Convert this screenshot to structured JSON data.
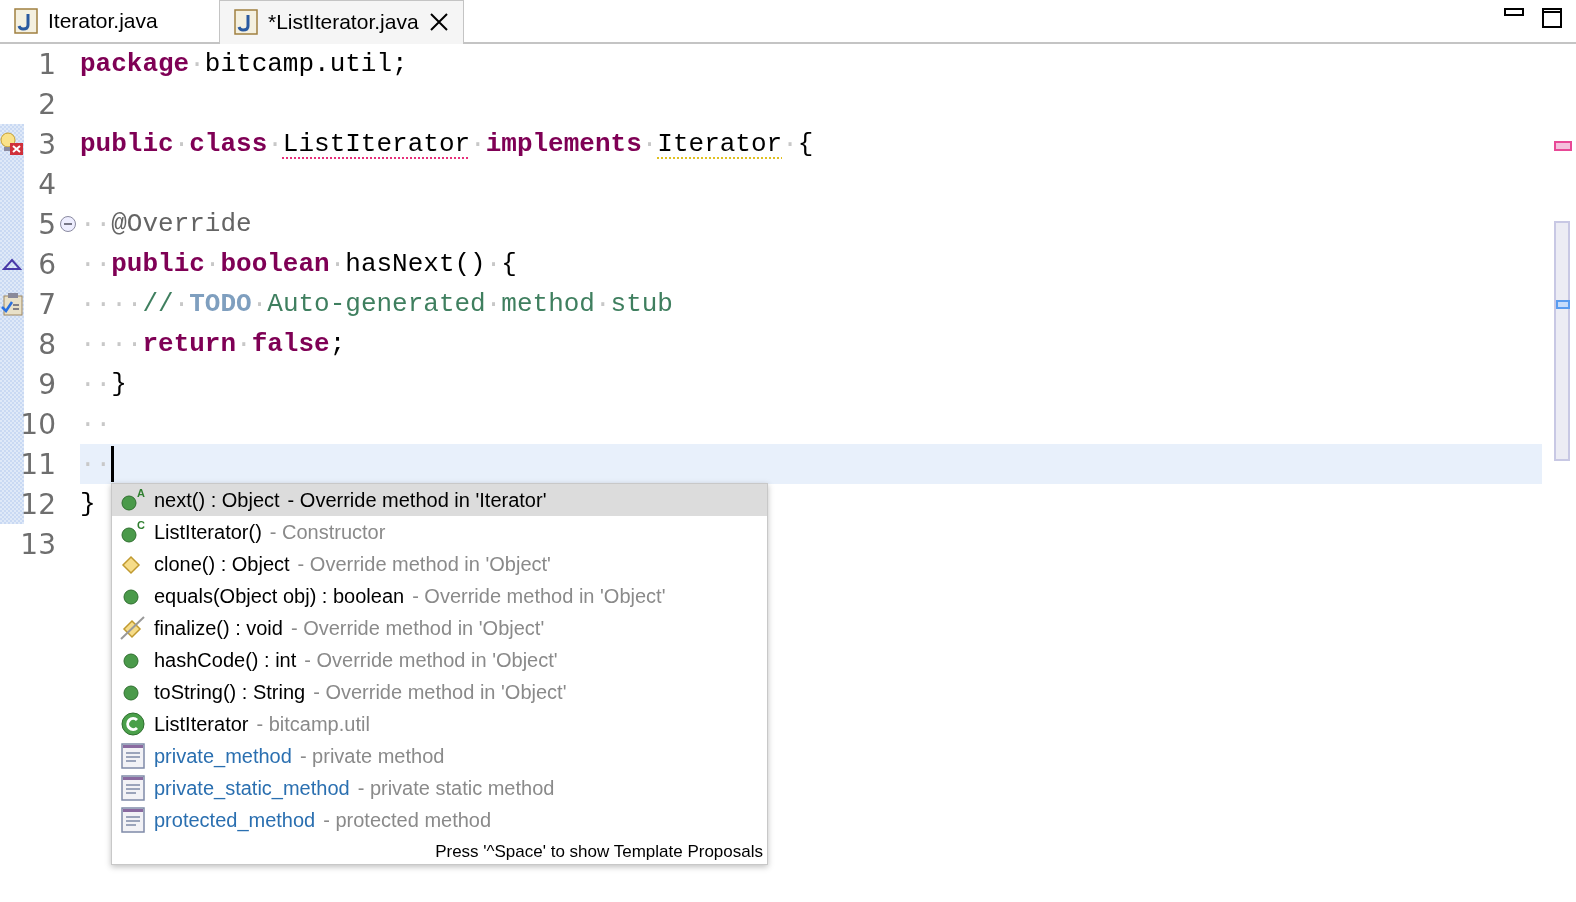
{
  "tabs": [
    {
      "label": "Iterator.java",
      "selected": false,
      "closable": false
    },
    {
      "label": "*ListIterator.java",
      "selected": true,
      "closable": true
    }
  ],
  "editor": {
    "lines": [
      {
        "number": "1",
        "current": false,
        "kind": "plain",
        "fold": false,
        "tokens": [
          {
            "kind": "keyword",
            "text": "package"
          },
          {
            "kind": "ws",
            "text": "·"
          },
          {
            "kind": "plain",
            "text": "bitcamp.util;"
          }
        ]
      },
      {
        "number": "2",
        "current": false,
        "kind": "plain",
        "fold": false
      },
      {
        "number": "3",
        "current": false,
        "kind": "error",
        "fold": false,
        "tokens": [
          {
            "kind": "keyword",
            "text": "public"
          },
          {
            "kind": "ws",
            "text": "·"
          },
          {
            "kind": "keyword",
            "text": "class"
          },
          {
            "kind": "ws",
            "text": "·"
          },
          {
            "kind": "error",
            "text": "ListIterator"
          },
          {
            "kind": "ws",
            "text": "·"
          },
          {
            "kind": "keyword",
            "text": "implements"
          },
          {
            "kind": "ws",
            "text": "·"
          },
          {
            "kind": "warning",
            "text": "Iterator"
          },
          {
            "kind": "ws",
            "text": "·"
          },
          {
            "kind": "plain",
            "text": "{"
          }
        ]
      },
      {
        "number": "4",
        "current": false,
        "kind": "plain",
        "fold": false
      },
      {
        "number": "5",
        "current": false,
        "kind": "plain",
        "fold": true,
        "tokens": [
          {
            "kind": "ws",
            "text": "··"
          },
          {
            "kind": "annotation",
            "text": "@Override"
          }
        ]
      },
      {
        "number": "6",
        "current": false,
        "kind": "override",
        "fold": false,
        "tokens": [
          {
            "kind": "ws",
            "text": "··"
          },
          {
            "kind": "keyword",
            "text": "public"
          },
          {
            "kind": "ws",
            "text": "·"
          },
          {
            "kind": "keyword",
            "text": "boolean"
          },
          {
            "kind": "ws",
            "text": "·"
          },
          {
            "kind": "plain",
            "text": "hasNext()"
          },
          {
            "kind": "ws",
            "text": "·"
          },
          {
            "kind": "plain",
            "text": "{"
          }
        ]
      },
      {
        "number": "7",
        "current": false,
        "kind": "task",
        "fold": false,
        "tokens": [
          {
            "kind": "ws",
            "text": "····"
          },
          {
            "kind": "comment",
            "text": "//"
          },
          {
            "kind": "ws",
            "text": "·"
          },
          {
            "kind": "todo",
            "text": "TODO"
          },
          {
            "kind": "ws",
            "text": "·"
          },
          {
            "kind": "comment",
            "text": "Auto-generated"
          },
          {
            "kind": "ws",
            "text": "·"
          },
          {
            "kind": "comment",
            "text": "method"
          },
          {
            "kind": "ws",
            "text": "·"
          },
          {
            "kind": "comment",
            "text": "stub"
          }
        ]
      },
      {
        "number": "8",
        "current": false,
        "kind": "plain",
        "fold": false,
        "tokens": [
          {
            "kind": "ws",
            "text": "····"
          },
          {
            "kind": "keyword",
            "text": "return"
          },
          {
            "kind": "ws",
            "text": "·"
          },
          {
            "kind": "keyword",
            "text": "false"
          },
          {
            "kind": "plain",
            "text": ";"
          }
        ]
      },
      {
        "number": "9",
        "current": false,
        "kind": "plain",
        "fold": false,
        "tokens": [
          {
            "kind": "ws",
            "text": "··"
          },
          {
            "kind": "plain",
            "text": "}"
          }
        ]
      },
      {
        "number": "10",
        "current": false,
        "kind": "plain",
        "fold": false,
        "tokens": [
          {
            "kind": "ws",
            "text": "··"
          }
        ]
      },
      {
        "number": "11",
        "current": true,
        "kind": "plain",
        "fold": false,
        "tokens": [
          {
            "kind": "ws",
            "text": "··"
          }
        ]
      },
      {
        "number": "12",
        "current": false,
        "kind": "plain",
        "fold": false,
        "tokens": [
          {
            "kind": "plain",
            "text": "}"
          }
        ]
      },
      {
        "number": "13",
        "current": false,
        "kind": "plain",
        "fold": false
      }
    ]
  },
  "completion": {
    "items": [
      {
        "kind": "abstract",
        "badge": "A",
        "name": "next() : Object",
        "detail": "- Override method in 'Iterator'",
        "selected": true
      },
      {
        "kind": "constructor",
        "badge": "C",
        "name": "ListIterator()",
        "detail": "- Constructor",
        "selected": false
      },
      {
        "kind": "protected",
        "name": "clone() : Object",
        "detail": "- Override method in 'Object'",
        "selected": false
      },
      {
        "kind": "public",
        "name": "equals(Object obj) : boolean",
        "detail": "- Override method in 'Object'",
        "selected": false
      },
      {
        "kind": "deprecated",
        "name": "finalize() : void",
        "detail": "- Override method in 'Object'",
        "selected": false
      },
      {
        "kind": "public",
        "name": "hashCode() : int",
        "detail": "- Override method in 'Object'",
        "selected": false
      },
      {
        "kind": "public",
        "name": "toString() : String",
        "detail": "- Override method in 'Object'",
        "selected": false
      },
      {
        "kind": "class",
        "name": "ListIterator",
        "detail": "- bitcamp.util",
        "selected": false
      },
      {
        "kind": "template",
        "name": "private_method",
        "detail": "- private method",
        "selected": false
      },
      {
        "kind": "template",
        "name": "private_static_method",
        "detail": "- private static method",
        "selected": false
      },
      {
        "kind": "template",
        "name": "protected_method",
        "detail": "- protected method",
        "selected": false
      }
    ],
    "footer": "Press '^Space' to show Template Proposals"
  }
}
